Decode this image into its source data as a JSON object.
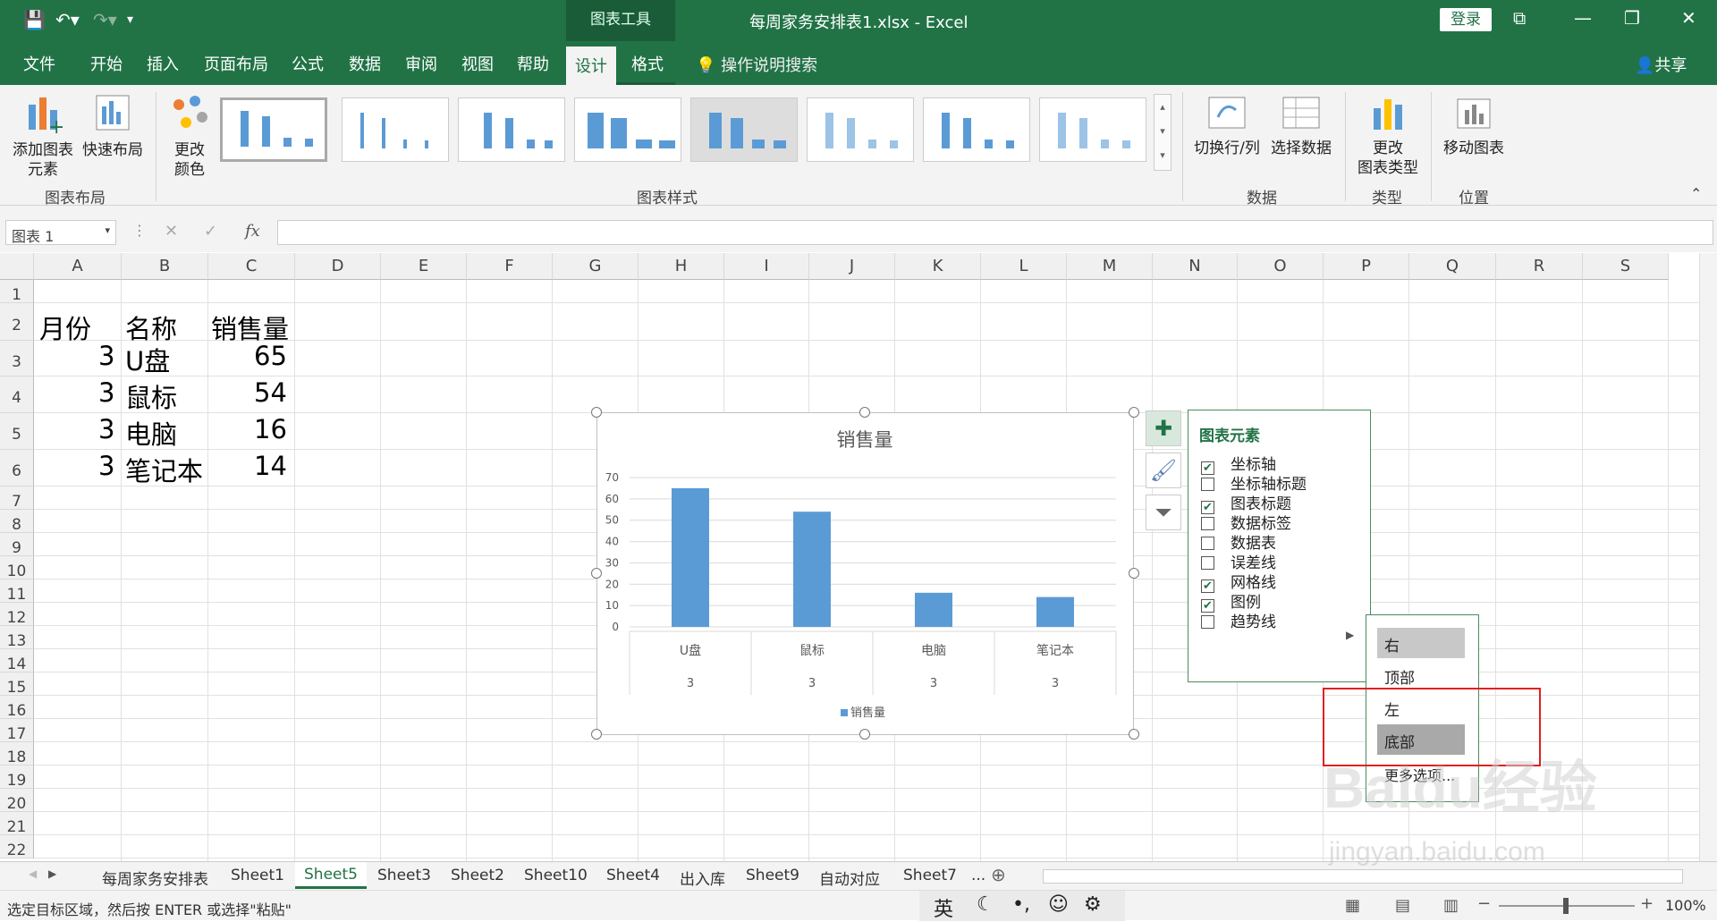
{
  "window": {
    "title": "每周家务安排表1.xlsx  -  Excel",
    "context_group": "图表工具",
    "login_label": "登录"
  },
  "tabs": [
    "文件",
    "开始",
    "插入",
    "页面布局",
    "公式",
    "数据",
    "审阅",
    "视图",
    "帮助",
    "设计",
    "格式"
  ],
  "active_tab": "设计",
  "search_label": "操作说明搜索",
  "share_label": "共享",
  "ribbon": {
    "add_element": "添加图表\n元素",
    "quick_layout": "快速布局",
    "change_colors": "更改\n颜色",
    "switch_row_col": "切换行/列",
    "select_data": "选择数据",
    "change_type": "更改\n图表类型",
    "move_chart": "移动图表",
    "groups": {
      "layout": "图表布局",
      "styles": "图表样式",
      "data": "数据",
      "type": "类型",
      "location": "位置"
    }
  },
  "name_box": "图表 1",
  "columns": [
    "A",
    "B",
    "C",
    "D",
    "E",
    "F",
    "G",
    "H",
    "I",
    "J",
    "K",
    "L",
    "M",
    "N",
    "O",
    "P",
    "Q",
    "R",
    "S"
  ],
  "rows": [
    "1",
    "2",
    "3",
    "4",
    "5",
    "6",
    "7",
    "8",
    "9",
    "10",
    "11",
    "12",
    "13",
    "14",
    "15",
    "16",
    "17",
    "18",
    "19",
    "20",
    "21",
    "22"
  ],
  "cells": {
    "headers": [
      "月份",
      "名称",
      "销售量"
    ],
    "data": [
      [
        "3",
        "U盘",
        "65"
      ],
      [
        "3",
        "鼠标",
        "54"
      ],
      [
        "3",
        "电脑",
        "16"
      ],
      [
        "3",
        "笔记本",
        "14"
      ]
    ]
  },
  "chart_data": {
    "type": "bar",
    "title": "销售量",
    "categories": [
      "U盘",
      "鼠标",
      "电脑",
      "笔记本"
    ],
    "category_sublabels": [
      "3",
      "3",
      "3",
      "3"
    ],
    "series": [
      {
        "name": "销售量",
        "values": [
          65,
          54,
          16,
          14
        ]
      }
    ],
    "yticks": [
      "0",
      "10",
      "20",
      "30",
      "40",
      "50",
      "60",
      "70"
    ],
    "ylim": [
      0,
      70
    ],
    "grid": true,
    "legend": "bottom",
    "color": "#5b9bd5"
  },
  "chart_elements_panel": {
    "title": "图表元素",
    "items": [
      {
        "label": "坐标轴",
        "checked": true
      },
      {
        "label": "坐标轴标题",
        "checked": false
      },
      {
        "label": "图表标题",
        "checked": true
      },
      {
        "label": "数据标签",
        "checked": false
      },
      {
        "label": "数据表",
        "checked": false
      },
      {
        "label": "误差线",
        "checked": false
      },
      {
        "label": "网格线",
        "checked": true
      },
      {
        "label": "图例",
        "checked": true
      },
      {
        "label": "趋势线",
        "checked": false
      }
    ]
  },
  "legend_submenu": [
    "右",
    "顶部",
    "左",
    "底部",
    "更多选项..."
  ],
  "sheets": [
    "每周家务安排表",
    "Sheet1",
    "Sheet5",
    "Sheet3",
    "Sheet2",
    "Sheet10",
    "Sheet4",
    "出入库",
    "Sheet9",
    "自动对应",
    "Sheet7",
    "..."
  ],
  "active_sheet": "Sheet5",
  "status_text": "选定目标区域，然后按 ENTER 或选择\"粘贴\"",
  "ime": "英",
  "zoom": "100%",
  "watermark": {
    "brand": "Baidu经验",
    "url": "jingyan.baidu.com"
  }
}
